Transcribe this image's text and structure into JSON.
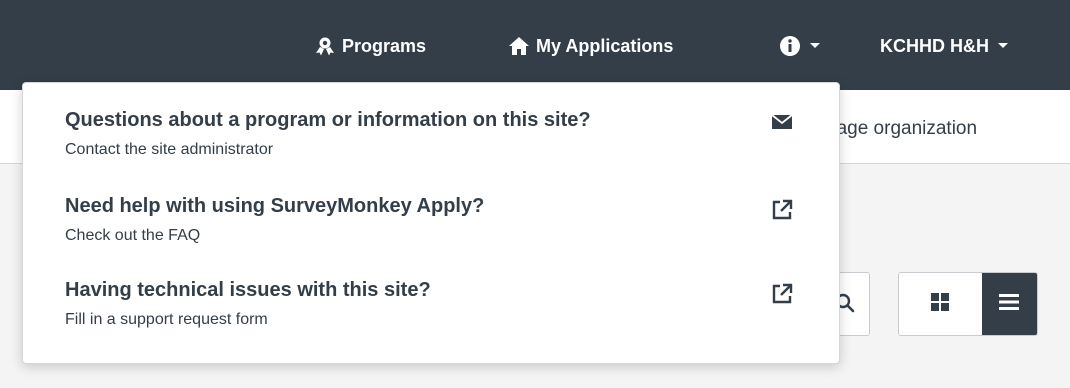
{
  "navbar": {
    "programs_label": "Programs",
    "programs_icon": "award-icon",
    "applications_label": "My Applications",
    "applications_icon": "home-icon",
    "info_icon": "info-circle-icon",
    "user_label": "KCHHD H&H",
    "background_color": "#333e48"
  },
  "subheader": {
    "manage_label": "nage organization"
  },
  "help_menu": {
    "items": [
      {
        "title": "Questions about a program or information on this site?",
        "subtitle": "Contact the site administrator",
        "icon": "envelope-icon"
      },
      {
        "title": "Need help with using SurveyMonkey Apply?",
        "subtitle": "Check out the FAQ",
        "icon": "external-link-icon"
      },
      {
        "title": "Having technical issues with this site?",
        "subtitle": "Fill in a support request form",
        "icon": "external-link-icon"
      }
    ]
  },
  "view_toggle": {
    "grid_icon": "grid-view-icon",
    "list_icon": "list-view-icon",
    "active": "list"
  }
}
